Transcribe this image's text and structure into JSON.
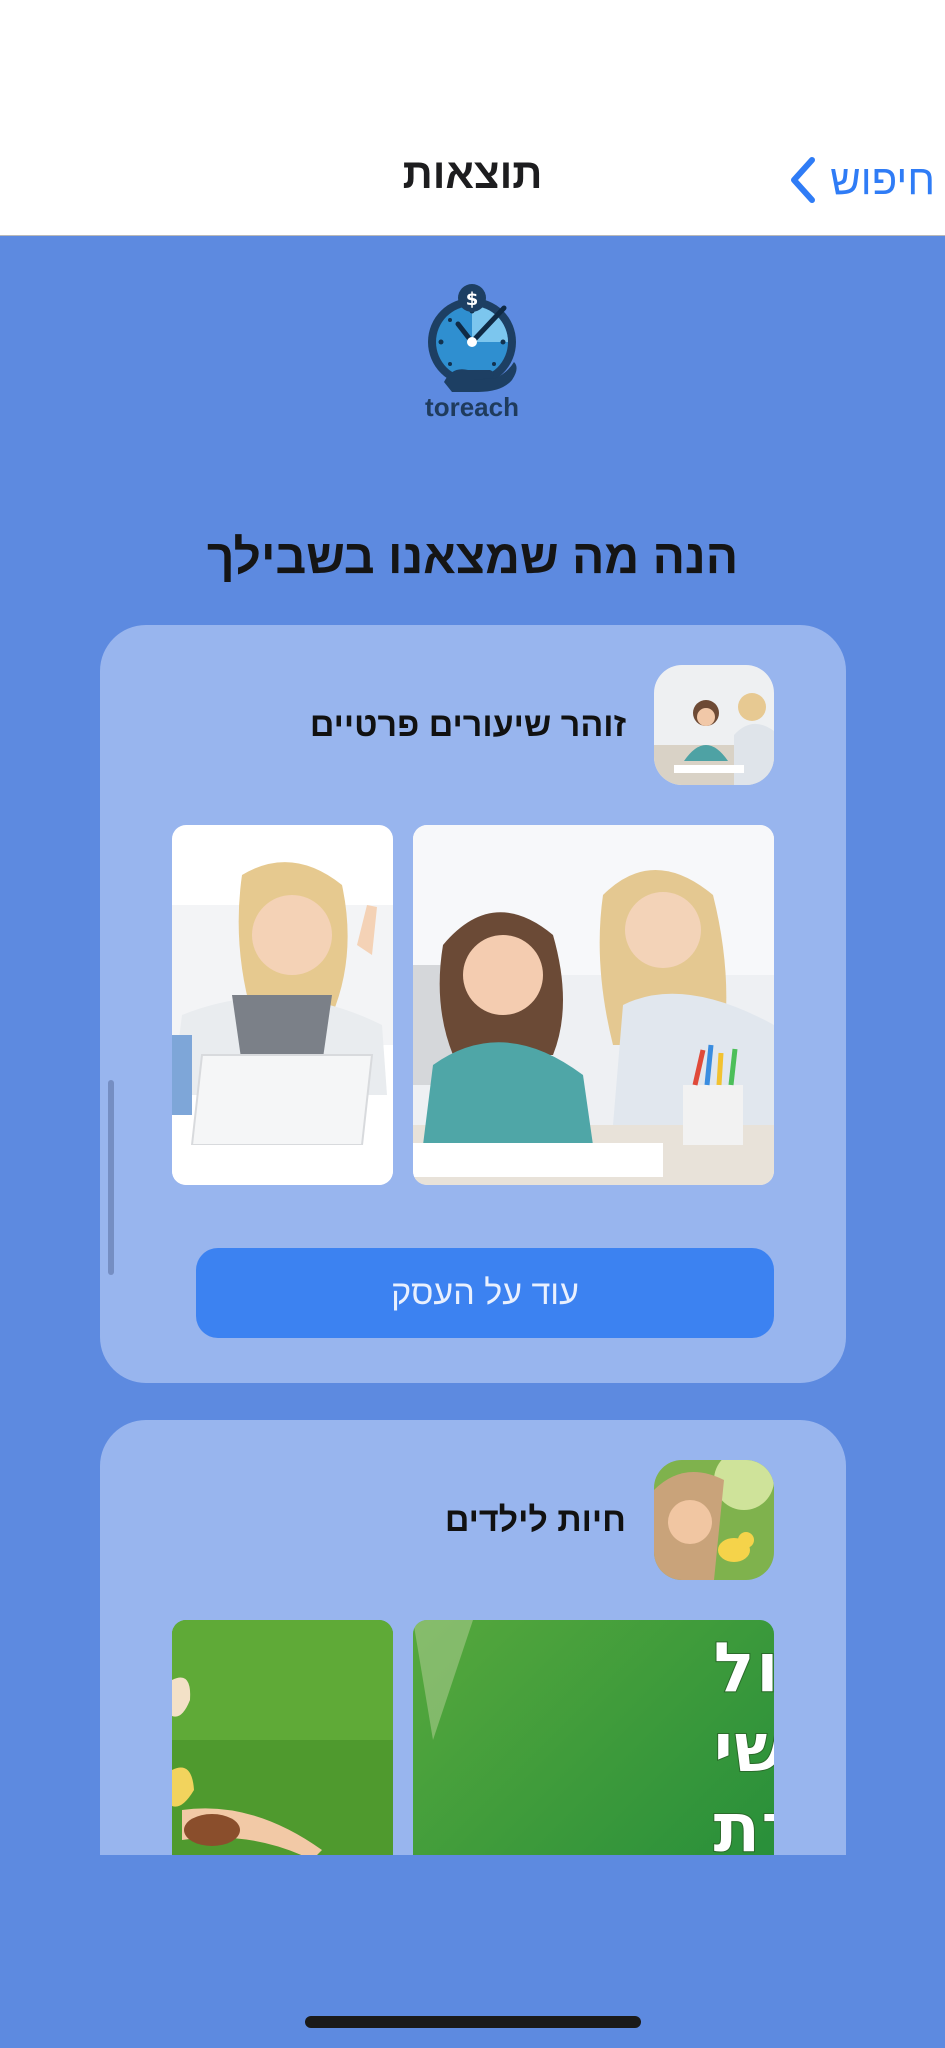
{
  "nav": {
    "title": "תוצאות",
    "back_label": "חיפוש",
    "back_icon": "chevron-left-icon"
  },
  "logo": {
    "text": "toreach",
    "icon": "clock-dollar-hand-icon"
  },
  "headline": "הנה מה שמצאנו בשבילך",
  "results": [
    {
      "name": "זוהר שיעורים פרטיים",
      "button_label": "עוד על העסק",
      "images": [
        "tutor-with-girl-photo",
        "teacher-at-laptop-photo"
      ]
    },
    {
      "name": "חיות לילדים",
      "images": [
        "therapy-poster",
        "child-on-grass-photo"
      ],
      "poster_text": [
        "טיפול",
        "רגשי",
        "בעזרת"
      ]
    }
  ],
  "colors": {
    "background": "#5d8ae0",
    "card": "#98b5ee",
    "button": "#3c82f1",
    "accent": "#2f7cf6"
  }
}
